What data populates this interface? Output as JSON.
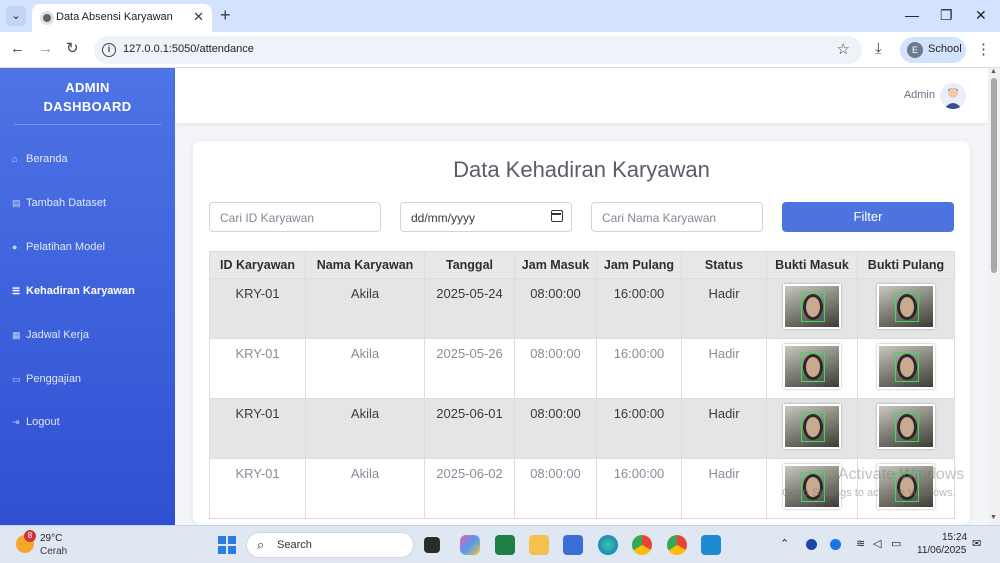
{
  "browser": {
    "tab_title": "Data Absensi Karyawan",
    "url": "127.0.0.1:5050/attendance",
    "profile_letter": "E",
    "profile_name": "School"
  },
  "sidebar": {
    "brand_line1": "ADMIN",
    "brand_line2": "DASHBOARD",
    "items": [
      {
        "label": "Beranda",
        "icon": "home-icon"
      },
      {
        "label": "Tambah Dataset",
        "icon": "dataset-icon"
      },
      {
        "label": "Pelatihan Model",
        "icon": "brain-icon"
      },
      {
        "label": "Kehadiran Karyawan",
        "icon": "list-icon",
        "active": true
      },
      {
        "label": "Jadwal Kerja",
        "icon": "calendar-icon"
      },
      {
        "label": "Penggajian",
        "icon": "money-icon"
      },
      {
        "label": "Logout",
        "icon": "logout-icon"
      }
    ]
  },
  "topbar": {
    "user_label": "Admin"
  },
  "main": {
    "title": "Data Kehadiran Karyawan",
    "search_id_placeholder": "Cari ID Karyawan",
    "date_placeholder": "dd/mm/yyyy",
    "search_name_placeholder": "Cari Nama Karyawan",
    "filter_label": "Filter",
    "table": {
      "headers": [
        "ID Karyawan",
        "Nama Karyawan",
        "Tanggal",
        "Jam Masuk",
        "Jam Pulang",
        "Status",
        "Bukti Masuk",
        "Bukti Pulang"
      ],
      "rows": [
        [
          "KRY-01",
          "Akila",
          "2025-05-24",
          "08:00:00",
          "16:00:00",
          "Hadir"
        ],
        [
          "KRY-01",
          "Akila",
          "2025-05-26",
          "08:00:00",
          "16:00:00",
          "Hadir"
        ],
        [
          "KRY-01",
          "Akila",
          "2025-06-01",
          "08:00:00",
          "16:00:00",
          "Hadir"
        ],
        [
          "KRY-01",
          "Akila",
          "2025-06-02",
          "08:00:00",
          "16:00:00",
          "Hadir"
        ]
      ]
    }
  },
  "watermark": {
    "line1": "Activate Windows",
    "line2": "Go to Settings to activate Windows."
  },
  "taskbar": {
    "weather_badge": "8",
    "temperature": "29°C",
    "weather_desc": "Cerah",
    "search_label": "Search",
    "time": "15:24",
    "date": "11/06/2025"
  },
  "colors": {
    "accent": "#4e73df",
    "sidebar_top": "#4e74e6",
    "sidebar_bottom": "#2f50d2"
  }
}
